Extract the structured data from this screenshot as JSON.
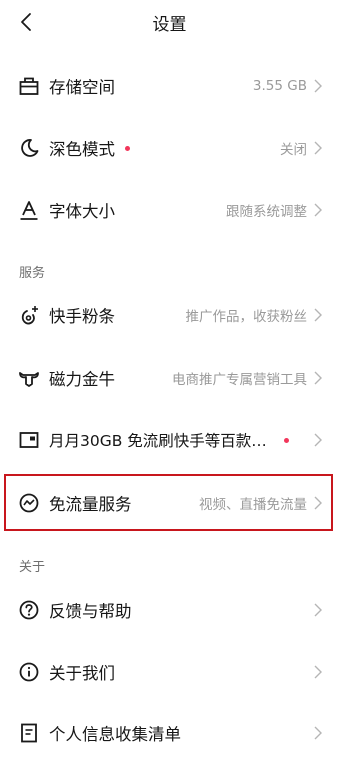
{
  "header": {
    "title": "设置"
  },
  "sections": [
    {
      "title": "服务"
    },
    {
      "title": "关于"
    }
  ],
  "rows": [
    {
      "label": "存储空间",
      "value": "3.55 GB"
    },
    {
      "label": "深色模式",
      "value": "关闭"
    },
    {
      "label": "字体大小",
      "value": "跟随系统调整"
    },
    {
      "label": "快手粉条",
      "value": "推广作品，收获粉丝"
    },
    {
      "label": "磁力金牛",
      "value": "电商推广专属营销工具"
    },
    {
      "label": "月月30GB 免流刷快手等百款…",
      "value": ""
    },
    {
      "label": "免流量服务",
      "value": "视频、直播免流量"
    },
    {
      "label": "反馈与帮助",
      "value": ""
    },
    {
      "label": "关于我们",
      "value": ""
    },
    {
      "label": "个人信息收集清单",
      "value": ""
    }
  ],
  "icons": {
    "back": "chevron-left-icon",
    "storage": "storage-icon",
    "dark_mode": "moon-icon",
    "font_size": "font-size-icon",
    "fans": "fans-boost-icon",
    "magnet": "bull-icon",
    "data_plan": "sim-card-icon",
    "free_data": "data-wave-icon",
    "help": "question-icon",
    "about": "info-icon",
    "privacy": "document-icon"
  },
  "colors": {
    "badge": "#f2365b",
    "highlight_border": "#c8161d",
    "text": "#161616",
    "secondary_text": "#9a9a9a"
  }
}
